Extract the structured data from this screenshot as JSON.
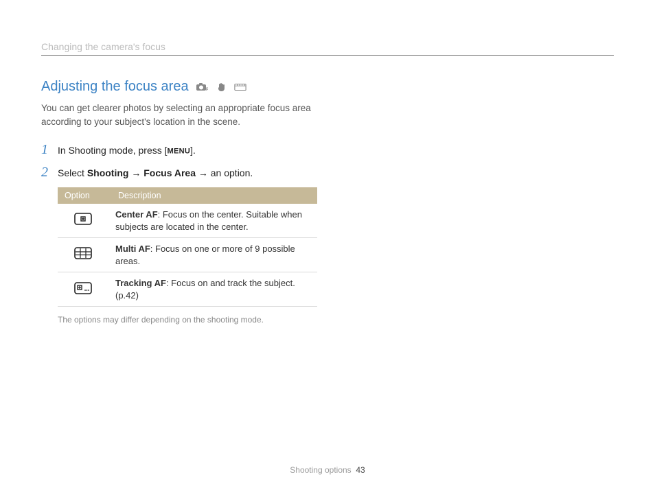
{
  "header": {
    "breadcrumb": "Changing the camera's focus"
  },
  "title": "Adjusting the focus area",
  "mode_icons": [
    "camera-p-icon",
    "hand-icon",
    "scene-icon"
  ],
  "intro": "You can get clearer photos by selecting an appropriate focus area according to your subject's location in the scene.",
  "steps": [
    {
      "num": "1",
      "prefix": "In Shooting mode, press [",
      "menu_label": "MENU",
      "suffix": "]."
    },
    {
      "num": "2",
      "prefix": "Select ",
      "bold1": "Shooting",
      "arrow1": " → ",
      "bold2": "Focus Area",
      "arrow2": " → ",
      "tail": "an option."
    }
  ],
  "table": {
    "col_option": "Option",
    "col_desc": "Description",
    "rows": [
      {
        "icon": "center-af-icon",
        "name": "Center AF",
        "desc": ": Focus on the center. Suitable when subjects are located in the center."
      },
      {
        "icon": "multi-af-icon",
        "name": "Multi AF",
        "desc": ": Focus on one or more of 9 possible areas."
      },
      {
        "icon": "tracking-af-icon",
        "name": "Tracking AF",
        "desc": ": Focus on and track the subject. (p.42)"
      }
    ]
  },
  "note": "The options may differ depending on the shooting mode.",
  "footer": {
    "section": "Shooting options",
    "page": "43"
  }
}
